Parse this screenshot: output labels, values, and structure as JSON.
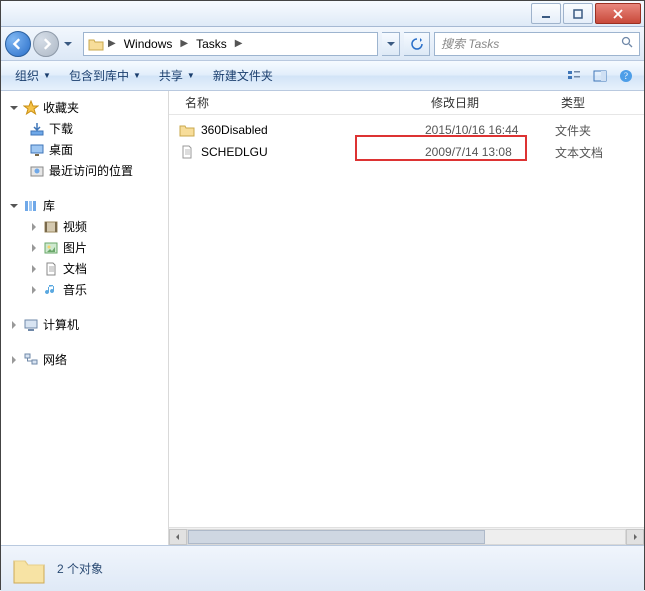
{
  "breadcrumb": {
    "seg1": "Windows",
    "seg2": "Tasks"
  },
  "search": {
    "placeholder": "搜索 Tasks"
  },
  "toolbar": {
    "organize": "组织",
    "include": "包含到库中",
    "share": "共享",
    "newfolder": "新建文件夹"
  },
  "columns": {
    "name": "名称",
    "date": "修改日期",
    "type": "类型"
  },
  "files": [
    {
      "name": "360Disabled",
      "date": "2015/10/16 16:44",
      "type": "文件夹",
      "kind": "folder"
    },
    {
      "name": "SCHEDLGU",
      "date": "2009/7/14 13:08",
      "type": "文本文档",
      "kind": "text"
    }
  ],
  "sidebar": {
    "favorites": "收藏夹",
    "downloads": "下载",
    "desktop": "桌面",
    "recent": "最近访问的位置",
    "libraries": "库",
    "videos": "视频",
    "pictures": "图片",
    "documents": "文档",
    "music": "音乐",
    "computer": "计算机",
    "network": "网络"
  },
  "status": {
    "text": "2 个对象"
  }
}
